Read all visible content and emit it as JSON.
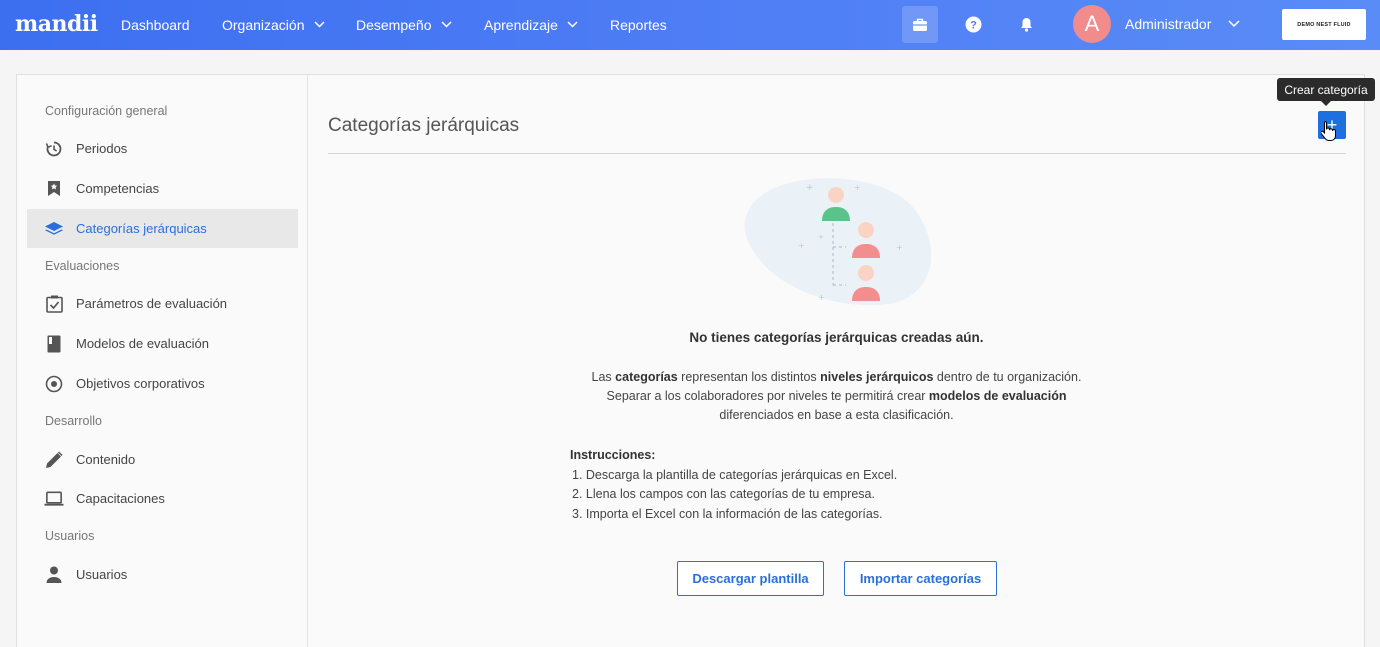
{
  "topbar": {
    "logo": "mandii",
    "nav": [
      {
        "label": "Dashboard",
        "dropdown": false
      },
      {
        "label": "Organización",
        "dropdown": true
      },
      {
        "label": "Desempeño",
        "dropdown": true
      },
      {
        "label": "Aprendizaje",
        "dropdown": true
      },
      {
        "label": "Reportes",
        "dropdown": false
      }
    ],
    "icons": [
      "briefcase-icon",
      "help-icon",
      "bell-icon"
    ],
    "avatar_initial": "A",
    "user_name": "Administrador",
    "company_logo_text": "DEMO NEST FLUID"
  },
  "sidebar": {
    "sections": [
      {
        "title": "Configuración general",
        "items": [
          {
            "label": "Periodos",
            "icon": "history-icon"
          },
          {
            "label": "Competencias",
            "icon": "bookmark-icon"
          },
          {
            "label": "Categorías jerárquicas",
            "icon": "layers-icon",
            "active": true
          }
        ]
      },
      {
        "title": "Evaluaciones",
        "items": [
          {
            "label": "Parámetros de evaluación",
            "icon": "checkbox-icon"
          },
          {
            "label": "Modelos de evaluación",
            "icon": "book-icon"
          },
          {
            "label": "Objetivos corporativos",
            "icon": "target-icon"
          }
        ]
      },
      {
        "title": "Desarrollo",
        "items": [
          {
            "label": "Contenido",
            "icon": "pencil-icon"
          },
          {
            "label": "Capacitaciones",
            "icon": "laptop-icon"
          }
        ]
      },
      {
        "title": "Usuarios",
        "items": [
          {
            "label": "Usuarios",
            "icon": "person-icon"
          }
        ]
      }
    ]
  },
  "content": {
    "page_title": "Categorías jerárquicas",
    "tooltip": "Crear categoría",
    "add_button": "+",
    "empty_title": "No tienes categorías jerárquicas creadas aún.",
    "desc": {
      "l1a": "Las ",
      "l1b": "categorías",
      "l1c": " representan los distintos ",
      "l1d": "niveles jerárquicos",
      "l1e": " dentro de tu organización.",
      "l2a": "Separar a los colaboradores por niveles te permitirá crear ",
      "l2b": "modelos de evaluación",
      "l3": "diferenciados en base a esta clasificación."
    },
    "instructions_title": "Instrucciones:",
    "steps": [
      "1. Descarga la plantilla de categorías jerárquicas en Excel.",
      "2. Llena los campos con las categorías de tu empresa.",
      "3. Importa el Excel con la información de las categorías."
    ],
    "download_button": "Descargar plantilla",
    "import_button": "Importar categorías"
  },
  "colors": {
    "primary": "#2a6fdb",
    "topbar": "#4e7df5",
    "avatar": "#f28b8b"
  }
}
